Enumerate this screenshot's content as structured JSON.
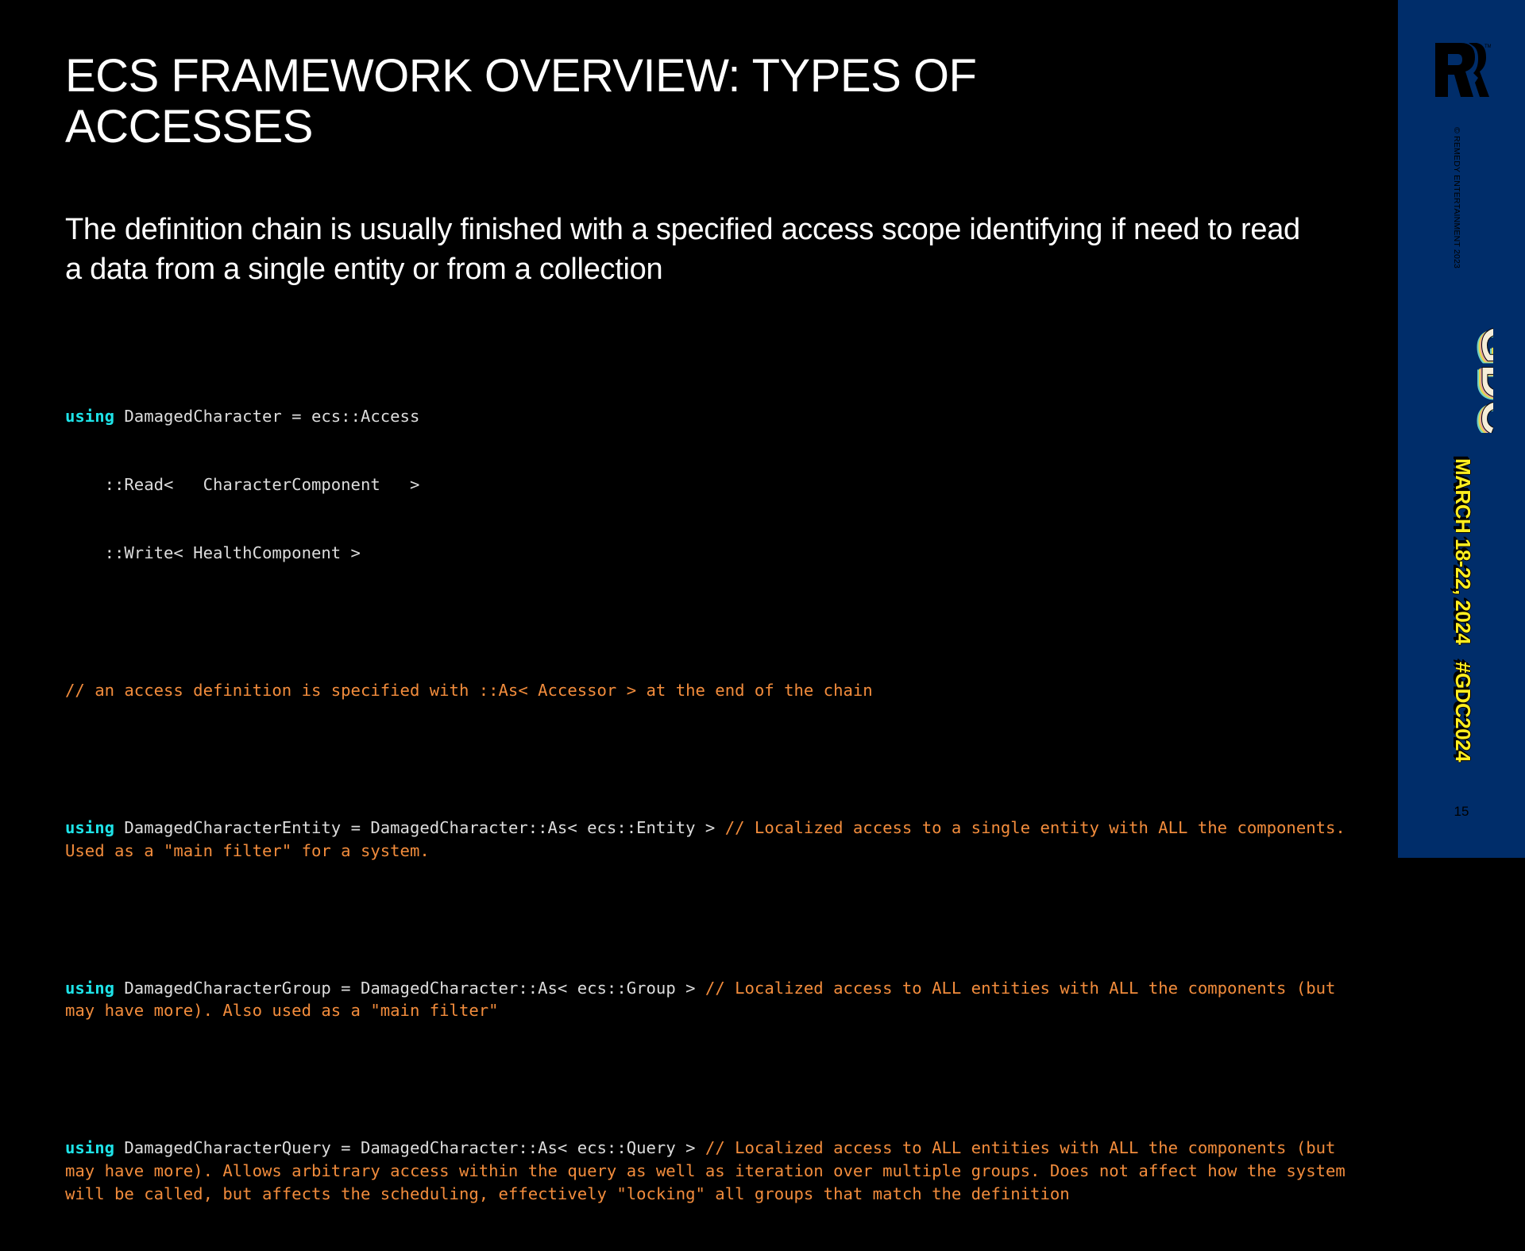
{
  "slide": {
    "title": "ECS FRAMEWORK OVERVIEW: TYPES OF ACCESSES",
    "subtitle": "The definition chain is usually finished with a specified access scope identifying if need to read a data from a single entity or from a collection",
    "code": {
      "block1": {
        "kw": "using",
        "line1": " DamagedCharacter = ecs::Access",
        "line2": "    ::Read<   CharacterComponent   >",
        "line3": "    ::Write< HealthComponent >"
      },
      "comment1": "// an access definition is specified with ::As< Accessor > at the end of the chain",
      "entity": {
        "kw": "using",
        "code": " DamagedCharacterEntity = DamagedCharacter::As< ecs::Entity > ",
        "comment": "// Localized access to a single entity with ALL the components. Used as a \"main filter\" for a system."
      },
      "group": {
        "kw": "using",
        "code": " DamagedCharacterGroup = DamagedCharacter::As< ecs::Group > ",
        "comment": "// Localized access to ALL entities with ALL the components (but may have more). Also used as a \"main filter\""
      },
      "query": {
        "kw": "using",
        "code": " DamagedCharacterQuery = DamagedCharacter::As< ecs::Query > ",
        "comment": "// Localized access to ALL entities with ALL the components (but may have more). Allows arbitrary access within the query as well as iteration over multiple groups. Does not affect how the system will be called, but affects the scheduling, effectively \"locking\" all groups that match the definition"
      }
    },
    "page_number": "15"
  },
  "sidebar": {
    "logo_icon": "remedy-logo",
    "copyright": "© REMEDY ENTERTAINMENT 2023",
    "event_logo_icon": "gdc-logo",
    "event_logo_text": "GDC",
    "dates": "MARCH 18-22, 2024",
    "hashtag": "#GDC2024"
  },
  "colors": {
    "background": "#000000",
    "sidebar": "#002d6a",
    "keyword": "#1ee3e8",
    "comment": "#f28c3c",
    "code_text": "#dcdcdc",
    "event_text": "#ffee1f"
  }
}
